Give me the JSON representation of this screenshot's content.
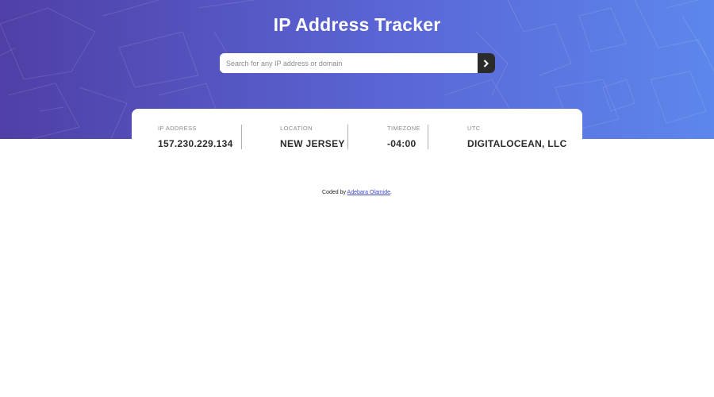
{
  "header": {
    "title": "IP Address Tracker"
  },
  "search": {
    "placeholder": "Search for any IP address or domain",
    "value": "",
    "button_icon": "chevron-right-icon"
  },
  "info": {
    "ip_label": "IP ADDRESS",
    "ip_value": "157.230.229.134",
    "location_label": "LOCATION",
    "location_value": "NEW JERSEY",
    "timezone_label": "TIMEZONE",
    "timezone_value": "-04:00",
    "isp_label": "UTC",
    "isp_value": "DIGITALOCEAN, LLC"
  },
  "footer": {
    "prefix": "Coded by ",
    "author": "Adebara Olamide",
    "suffix": "."
  },
  "colors": {
    "hero_start": "#4f3fa6",
    "hero_end": "#5c87ec",
    "button": "#2b2b2b",
    "link": "#3b4bc8"
  }
}
